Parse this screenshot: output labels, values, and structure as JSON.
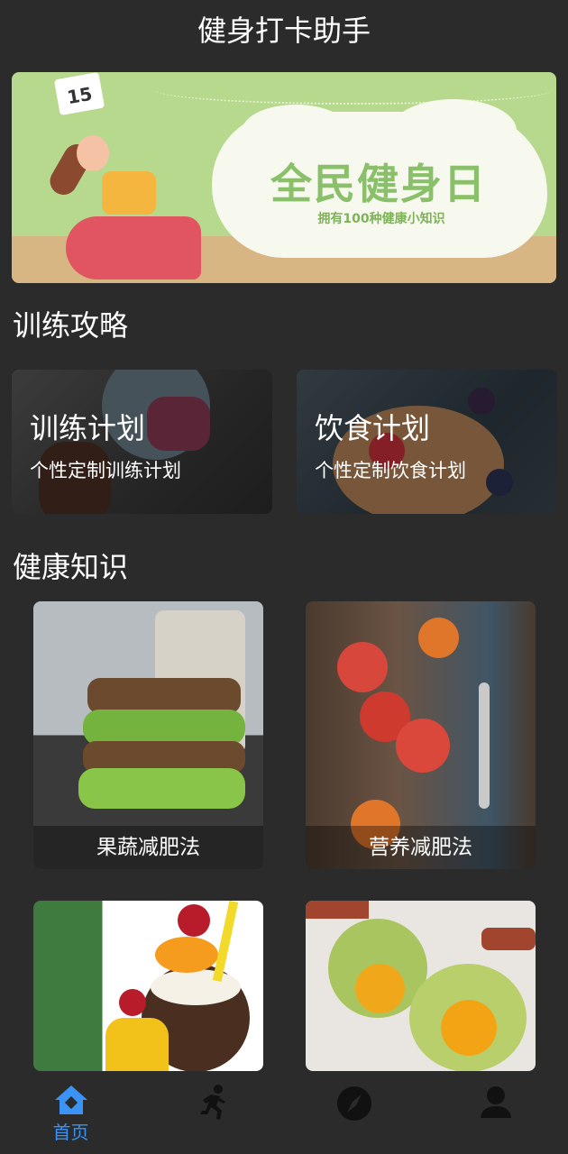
{
  "app": {
    "title": "健身打卡助手"
  },
  "banner": {
    "title": "全民健身日",
    "subtitle": "拥有100种健康小知识",
    "calendar_number": "15"
  },
  "sections": {
    "training": "训练攻略",
    "health": "健康知识"
  },
  "cards": [
    {
      "title": "训练计划",
      "subtitle": "个性定制训练计划"
    },
    {
      "title": "饮食计划",
      "subtitle": "个性定制饮食计划"
    }
  ],
  "tiles": [
    {
      "caption": "果蔬减肥法"
    },
    {
      "caption": "营养减肥法"
    }
  ],
  "tabbar": {
    "active_color": "#3a93f5",
    "inactive_color": "#111111",
    "items": [
      {
        "icon": "home-icon",
        "label": "首页"
      },
      {
        "icon": "running-icon"
      },
      {
        "icon": "compass-icon"
      },
      {
        "icon": "user-icon"
      }
    ]
  }
}
